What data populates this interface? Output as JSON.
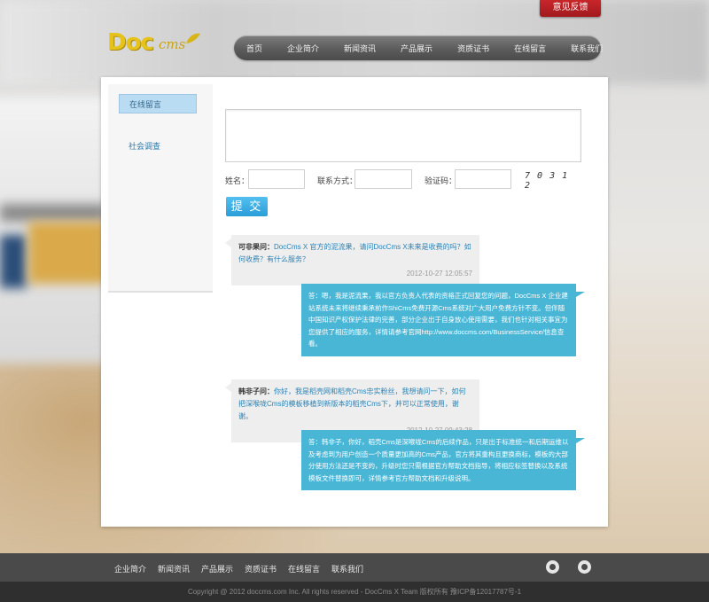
{
  "header": {
    "feedback_label": "意见反馈",
    "logo": {
      "main": "Doc",
      "sub": "cms"
    },
    "nav": [
      "首页",
      "企业简介",
      "新闻资讯",
      "产品展示",
      "资质证书",
      "在线留言",
      "联系我们"
    ]
  },
  "sidebar": {
    "items": [
      {
        "label": "在线留言",
        "active": true
      },
      {
        "label": "社会调查",
        "active": false
      }
    ]
  },
  "form": {
    "message_value": "",
    "name_label": "姓名：",
    "name_value": "",
    "contact_label": "联系方式：",
    "contact_value": "",
    "captcha_label": "验证码：",
    "captcha_value": "",
    "captcha_image_text": "7 0 3 1 2",
    "submit_label": "提 交"
  },
  "messages": [
    {
      "author": "可非果问：",
      "question": "DocCms X 官方的泥流果，请问DocCms X未来是收费的吗？如何收费？有什么服务？",
      "date": "2012-10-27 12:05:57",
      "reply": "答：嗯，我是泥流果，我以官方负责人代表的资格正式回复您的问题，DocCms X 企业建站系统未来将继续秉承前作ShiCms免费开源Cms系统对广大用户免费方针不变。但伴随中国知识产权保护法律的完善，部分企业出于自身放心使用需要，我们也针对相关事宜为您提供了相应的服务，详情请参考官网http://www.doccms.com/BusinessService/信息查看。"
    },
    {
      "author": "韩非子问：",
      "question": "你好，我是稻壳网和稻壳Cms忠实粉丝，我想请问一下，如何把深喉咙Cms的模板移植到新版本的稻壳Cms下，并可以正常使用，谢谢。",
      "date": "2012-10-27 09:43:28",
      "reply": "答：韩非子，你好，稻壳Cms是深喉咙Cms的后续作品，只是出于标准统一和后期运维以及考虑到为用户创造一个质量更加高的Cms产品，官方将其重构且更换商标，模板的大部分使用方法还是不变的，升级时您只需根据官方帮助文档指导，将相应标签替换以及系统模板文件替换即可，详情参考官方帮助文档和升级说明。"
    }
  ],
  "footer": {
    "links": [
      "企业简介",
      "新闻资讯",
      "产品展示",
      "资质证书",
      "在线留言",
      "联系我们"
    ],
    "icons": [
      "weibo-icon",
      "tencent-weibo-icon"
    ],
    "copyright": "Copyright @ 2012 doccms.com Inc. All rights reserved - DocCms X Team   版权所有  豫ICP备12017787号-1"
  }
}
